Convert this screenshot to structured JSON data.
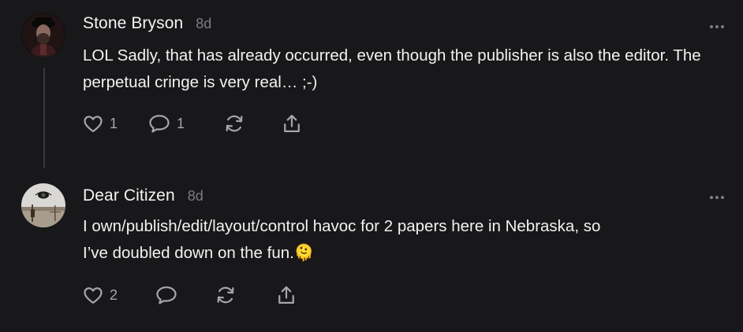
{
  "comments": [
    {
      "author": "Stone Bryson",
      "time": "8d",
      "text": "LOL Sadly, that has already occurred, even though the publisher is also the editor. The perpetual cringe is very real… ;-)",
      "likes": "1",
      "replies": "1",
      "icons": [
        "heart-icon",
        "speech-bubble-icon",
        "restack-icon",
        "share-icon",
        "more-dots-icon"
      ]
    },
    {
      "author": "Dear Citizen",
      "time": "8d",
      "text_line1": "I own/publish/edit/layout/control havoc for 2 papers here in Nebraska, so",
      "text_line2": "I’ve doubled down on the fun.",
      "emoji": "🫠",
      "likes": "2",
      "icons": [
        "heart-icon",
        "speech-bubble-icon",
        "restack-icon",
        "share-icon",
        "more-dots-icon"
      ]
    }
  ],
  "colors": {
    "background": "#18181a",
    "text": "#f2f2f2",
    "muted": "#7d7d80",
    "icon": "#a6a6a9",
    "thread_line": "#38383b"
  }
}
